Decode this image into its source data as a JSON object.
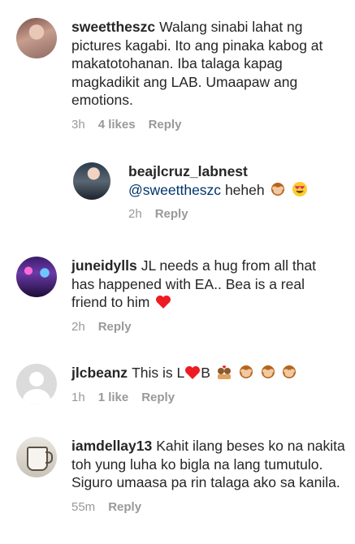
{
  "comments": [
    {
      "username": "sweettheszc",
      "text": "Walang sinabi lahat ng pictures kagabi. Ito ang pinaka kabog at makatotohanan. Iba talaga kapag magkadikit ang LAB. Umaapaw ang emotions.",
      "time": "3h",
      "likes": "4 likes",
      "reply_label": "Reply"
    },
    {
      "username": "beajlcruz_labnest",
      "mention": "@sweettheszc",
      "text": "heheh",
      "emoji": [
        "see-no-evil-monkey-icon",
        "heart-eyes-face-icon"
      ],
      "time": "2h",
      "reply_label": "Reply"
    },
    {
      "username": "juneidylls",
      "text": "JL needs a hug from all that has happened with EA.. Bea is a real friend to him",
      "emoji": [
        "red-heart-icon"
      ],
      "time": "2h",
      "reply_label": "Reply"
    },
    {
      "username": "jlcbeanz",
      "text_before": "This is L",
      "text_after": "B",
      "emoji": [
        "red-heart-icon",
        "couple-with-heart-icon",
        "see-no-evil-monkey-icon",
        "see-no-evil-monkey-icon",
        "see-no-evil-monkey-icon"
      ],
      "time": "1h",
      "likes": "1 like",
      "reply_label": "Reply"
    },
    {
      "username": "iamdellay13",
      "text": "Kahit ilang beses ko na nakita toh yung luha ko bigla na lang tumutulo.  Siguro umaasa pa rin talaga ako sa kanila.",
      "time": "55m",
      "reply_label": "Reply"
    }
  ],
  "colors": {
    "text": "#262626",
    "meta": "#999999",
    "mention": "#003569",
    "heart": "#ed1c24",
    "monkey": "#b5651d"
  }
}
